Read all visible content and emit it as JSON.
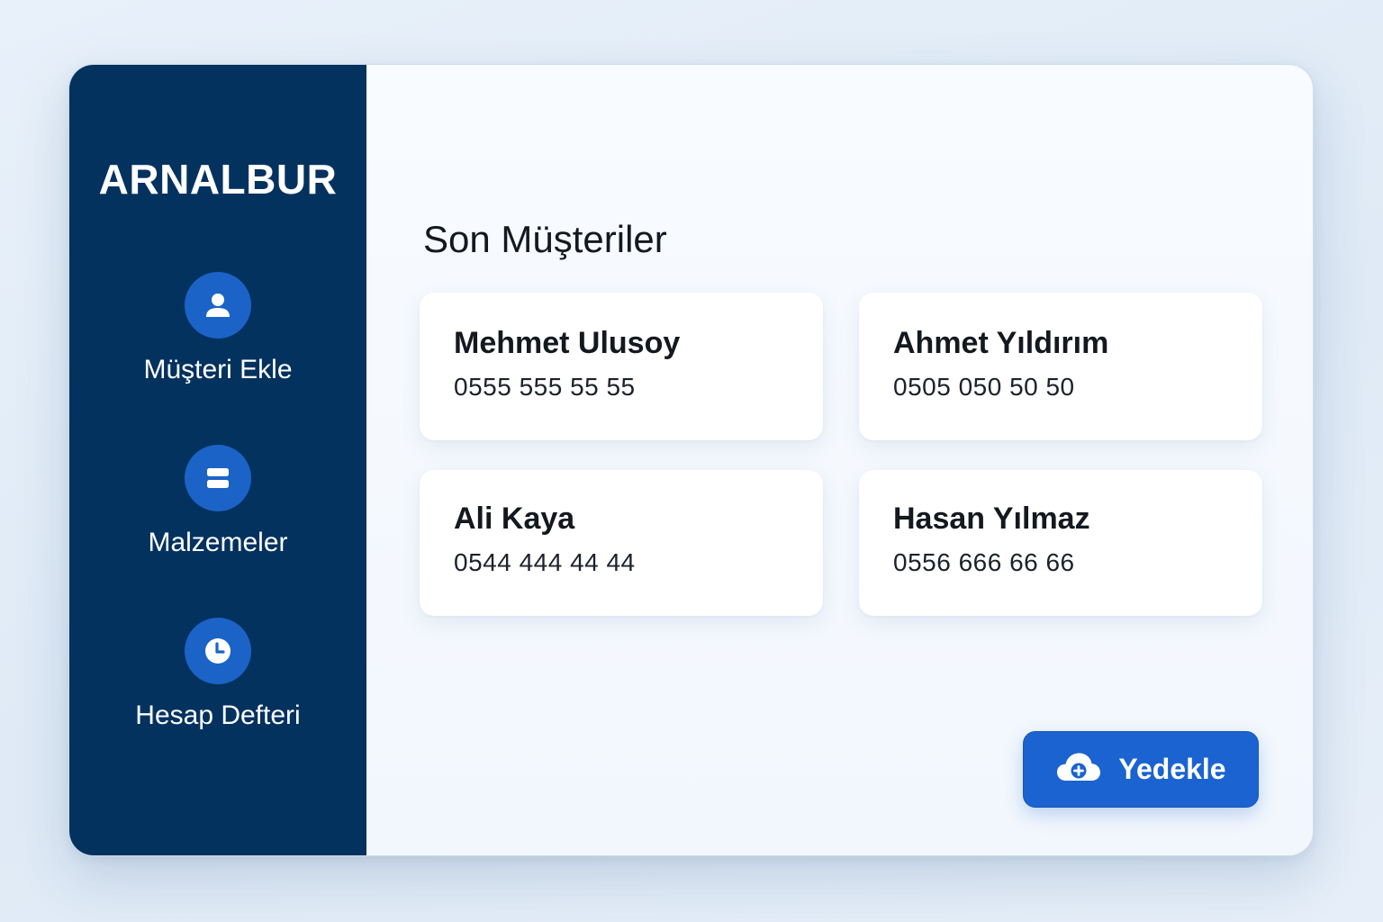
{
  "app": {
    "brand": "ARNALBUR"
  },
  "sidebar": {
    "items": [
      {
        "label": "Müşteri Ekle",
        "icon": "user-icon"
      },
      {
        "label": "Malzemeler",
        "icon": "stack-icon"
      },
      {
        "label": "Hesap Defteri",
        "icon": "clock-icon"
      }
    ]
  },
  "main": {
    "title": "Son Müşteriler",
    "customers": [
      {
        "name": "Mehmet Ulusoy",
        "phone": "0555 555 55 55"
      },
      {
        "name": "Ahmet Yıldırım",
        "phone": "0505 050 50 50"
      },
      {
        "name": "Ali Kaya",
        "phone": "0544 444 44 44"
      },
      {
        "name": "Hasan Yılmaz",
        "phone": "0556 666 66 66"
      }
    ],
    "backup_button": {
      "label": "Yedekle",
      "icon": "cloud-plus-icon"
    }
  },
  "colors": {
    "sidebar_bg": "#04325f",
    "accent": "#1b63c7",
    "button_bg": "#1b63d0"
  }
}
